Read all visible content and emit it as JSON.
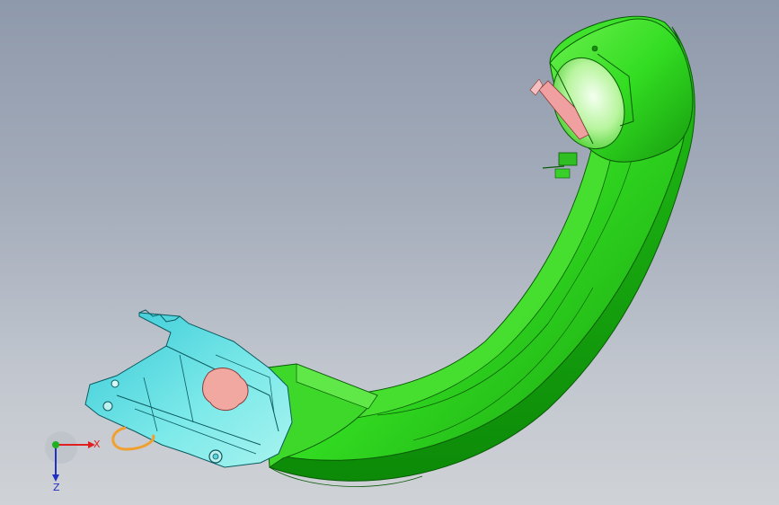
{
  "viewport": {
    "background_top": "#8e99ab",
    "background_bottom": "#cfd2d6"
  },
  "model": {
    "colors": {
      "handle_green": "#33dd22",
      "handle_dark_green": "#0f9a0a",
      "handle_light_green": "#7cf060",
      "part_cyan": "#3fd6dc",
      "part_cyan_light": "#8ff0f0",
      "part_pink": "#f0a0a0",
      "part_orange": "#f0a030"
    }
  },
  "triad": {
    "x_label": "X",
    "z_label": "Z",
    "colors": {
      "x": "#e02020",
      "y": "#20b020",
      "z": "#2030c0"
    }
  }
}
